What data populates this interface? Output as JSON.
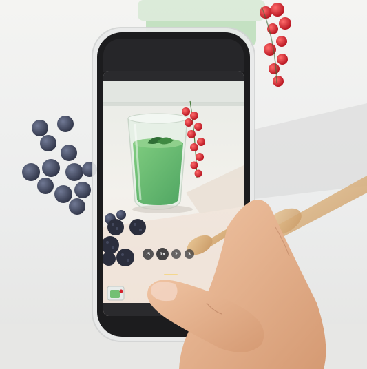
{
  "scene": {
    "description_colors": {
      "background": "#f2f2f0",
      "smoothie": "#6fbf73",
      "phone_frame": "#1c1c1e",
      "currant": "#d4202c",
      "berry": "#2f3650",
      "spoon": "#d9b07c",
      "skin": "#e7b591"
    }
  },
  "camera_ui": {
    "zoom_options": [
      {
        "label": ".5"
      },
      {
        "label": "1x"
      },
      {
        "label": "2"
      },
      {
        "label": "3"
      }
    ],
    "selected_zoom_index": 1
  },
  "icons": {
    "thumbnail": "gallery-thumbnail-icon"
  }
}
